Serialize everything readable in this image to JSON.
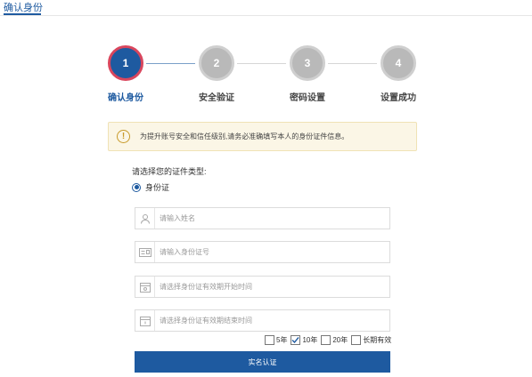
{
  "page": {
    "tab_label": "确认身份"
  },
  "steps": [
    {
      "number": "1",
      "label": "确认身份"
    },
    {
      "number": "2",
      "label": "安全验证"
    },
    {
      "number": "3",
      "label": "密码设置"
    },
    {
      "number": "4",
      "label": "设置成功"
    }
  ],
  "notice": {
    "icon": "!",
    "text": "为提升账号安全和信任级别,请务必准确填写本人的身份证件信息。"
  },
  "form": {
    "prompt": "请选择您的证件类型:",
    "id_type_option": "身份证",
    "name_placeholder": "请输入姓名",
    "id_number_placeholder": "请输入身份证号",
    "start_date_placeholder": "请选择身份证有效期开始时间",
    "end_date_placeholder": "请选择身份证有效期结束时间",
    "validity_options": [
      {
        "label": "5年",
        "checked": false
      },
      {
        "label": "10年",
        "checked": true
      },
      {
        "label": "20年",
        "checked": false
      },
      {
        "label": "长期有效",
        "checked": false
      }
    ],
    "submit_label": "实名认证"
  },
  "colors": {
    "primary": "#1e5aa0",
    "active_ring": "#d9465d",
    "inactive_step": "#b9b9b9",
    "notice_bg": "#fbf6e6"
  }
}
